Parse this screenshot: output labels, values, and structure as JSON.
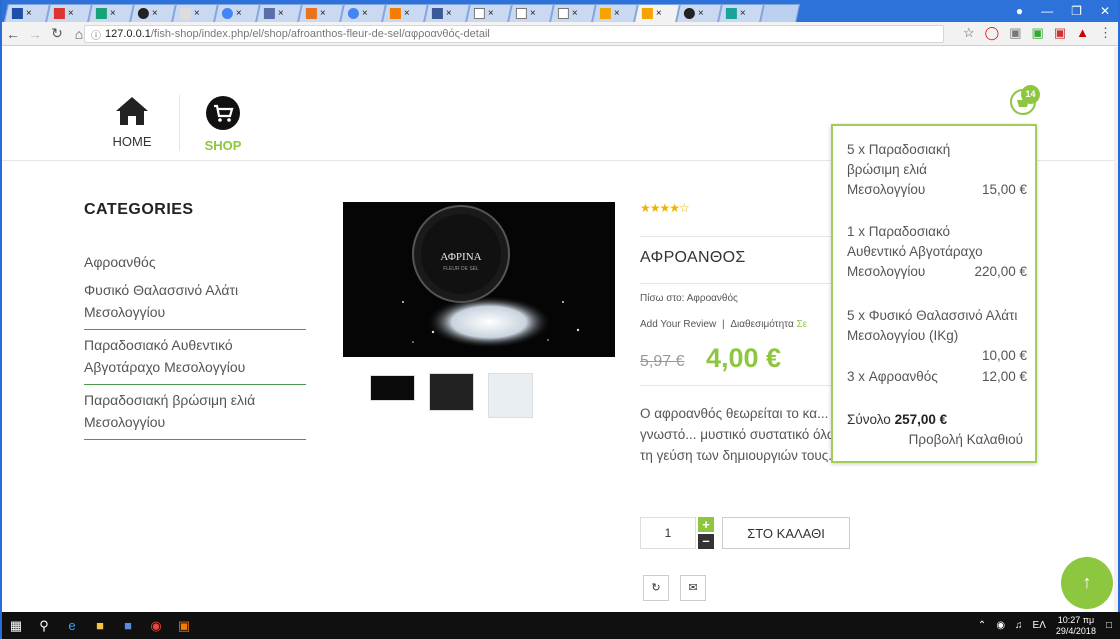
{
  "browser": {
    "tab_count_label": "",
    "address_host": "127.0.0.1",
    "address_path": "/fish-shop/index.php/el/shop/afroanthos-fleur-de-sel/αφροανθός-detail",
    "secure_icon": "info-icon"
  },
  "nav": {
    "home_label": "HOME",
    "shop_label": "SHOP",
    "cart_count": "14"
  },
  "categories": {
    "heading": "CATEGORIES",
    "items": [
      {
        "label": "Αφροανθός"
      },
      {
        "label": "Φυσικό Θαλασσινό Αλάτι Μεσολογγίου"
      },
      {
        "label": "Παραδοσιακό Αυθεντικό Αβγοτάραχο Μεσολογγίου"
      },
      {
        "label": "Παραδοσιακή βρώσιμη ελιά Μεσολογγίου"
      }
    ]
  },
  "product": {
    "image_brand": "ΑΦΡΙΝΑ",
    "image_sub": "FLEUR DE SEL",
    "rating_text": "★★★★☆",
    "rating": 4,
    "title": "ΑΦΡΟΑΝΘΟΣ",
    "back_text": "Πίσω στο: Αφροανθός",
    "review_link": "Add Your Review",
    "review_sep": "|",
    "availability_label": "Διαθεσιμότητα",
    "availability_value": "Σε",
    "old_price": "5,97 €",
    "new_price": "4,00 €",
    "description": "Ο αφροανθός θεωρείται το κα... παγκόσμιος, διεθνώς γνωστό... μυστικό συστατικό όλων των ... για να απογειώσουν τη γεύση των δημιουργιών τους.",
    "quantity": "1",
    "plus_label": "+",
    "minus_label": "–",
    "add_to_cart": "ΣΤΟ ΚΑΛΑΘΙ",
    "refresh_icon": "refresh-icon",
    "mail_icon": "mail-icon"
  },
  "cart_popup": {
    "items": [
      {
        "text": "5 x Παραδοσιακή βρώσιμη ελιά Μεσολογγίου",
        "price": "15,00 €"
      },
      {
        "text": "1 x Παραδοσιακό Αυθεντικό Αβγοτάραχο Μεσολογγίου",
        "price": "220,00 €"
      },
      {
        "text": "5 x Φυσικό Θαλασσινό Αλάτι Μεσολογγίου (IKg)",
        "price": "10,00 €"
      },
      {
        "text": "3 x Αφροανθός",
        "price": "12,00 €"
      }
    ],
    "total_label": "Σύνολο",
    "total_value": "257,00 €",
    "view_cart": "Προβολή Καλαθιού"
  },
  "scroll_top_icon": "arrow-up-icon",
  "taskbar": {
    "time": "10:27 πμ",
    "date": "29/4/2018",
    "lang": "ΕΛ"
  },
  "colors": {
    "accent": "#8dc63f",
    "browser_frame": "#2d72d9"
  }
}
